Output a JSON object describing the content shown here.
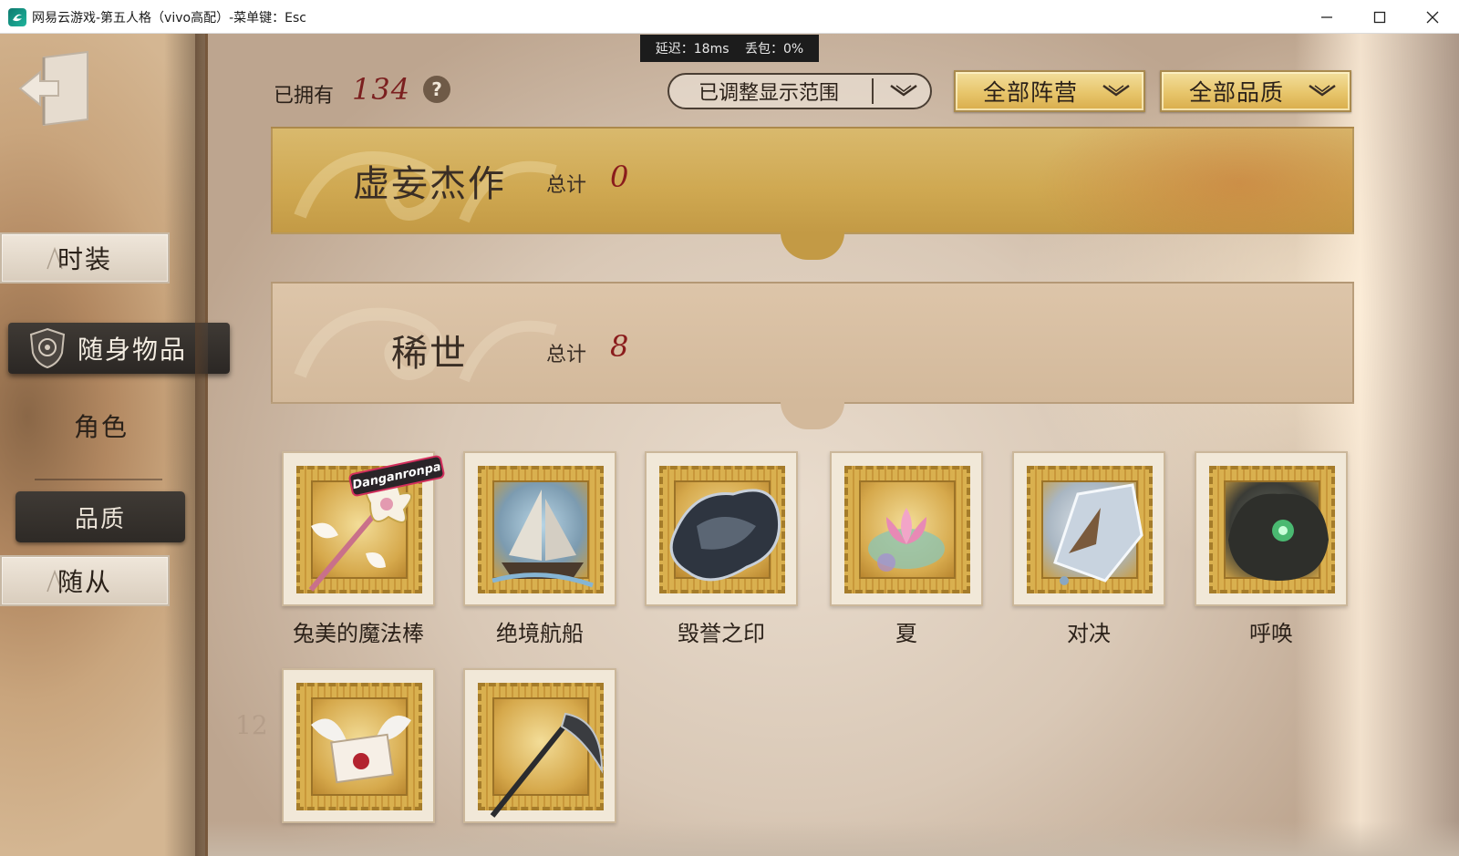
{
  "window": {
    "title": "网易云游戏-第五人格（vivo高配）-菜单键：Esc"
  },
  "network": {
    "latency": "延迟：18ms",
    "packet_loss": "丢包：0%"
  },
  "sidebar": {
    "tabs": [
      "时装",
      "随身物品",
      "角色"
    ],
    "quality_button": "品质",
    "follower_tab": "随从"
  },
  "toolbar": {
    "owned_label": "已拥有",
    "owned_count": "134",
    "help_glyph": "?",
    "range_filter": "已调整显示范围",
    "camp_filter": "全部阵营",
    "quality_filter": "全部品质"
  },
  "sections": [
    {
      "name": "虚妄杰作",
      "total_label": "总计",
      "total": "0"
    },
    {
      "name": "稀世",
      "total_label": "总计",
      "total": "8"
    }
  ],
  "items": [
    {
      "name": "兔美的魔法棒",
      "icon": "magic-wand-icon"
    },
    {
      "name": "绝境航船",
      "icon": "ship-icon"
    },
    {
      "name": "毁誉之印",
      "icon": "dark-seal-icon"
    },
    {
      "name": "夏",
      "icon": "lotus-icon"
    },
    {
      "name": "对决",
      "icon": "duel-crystal-icon"
    },
    {
      "name": "呼唤",
      "icon": "summon-rock-icon"
    },
    {
      "name": "",
      "icon": "winged-letter-icon"
    },
    {
      "name": "",
      "icon": "scythe-icon"
    }
  ],
  "item_badge_text": "Danganronpa",
  "colors": {
    "gold_button": "#e7c56b",
    "count_red": "#8a1c1c",
    "active_tab": "#2b2724"
  }
}
